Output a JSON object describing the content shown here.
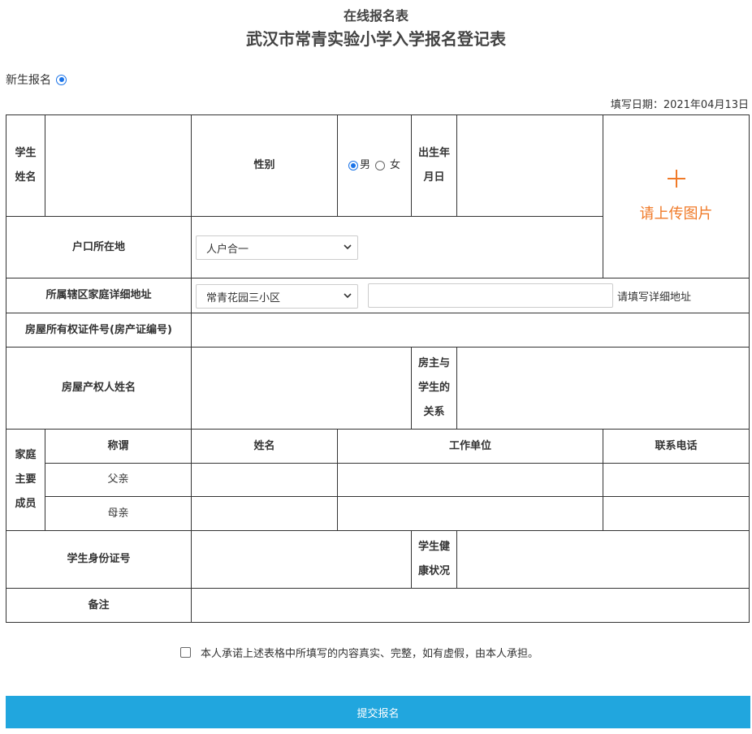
{
  "header": {
    "subtitle": "在线报名表",
    "title": "武汉市常青实验小学入学报名登记表"
  },
  "registration_type": {
    "label": "新生报名",
    "selected": true
  },
  "fill_date": "填写日期：2021年04月13日",
  "form": {
    "student_name_label": "学生姓名",
    "gender_label": "性别",
    "gender_options": [
      "男",
      "女"
    ],
    "gender_selected": "男",
    "birth_label": "出生年月日",
    "upload_label": "请上传图片",
    "hukou_label": "户口所在地",
    "hukou_value": "人户合一",
    "address_label": "所属辖区家庭详细地址",
    "address_select_value": "常青花园三小区",
    "address_hint": "请填写详细地址",
    "property_cert_label": "房屋所有权证件号(房产证编号)",
    "owner_name_label": "房屋产权人姓名",
    "owner_relation_label": "房主与学生的关系",
    "family_label": "家庭主要成员",
    "family_headers": [
      "称谓",
      "姓名",
      "工作单位",
      "联系电话"
    ],
    "family_rows": [
      "父亲",
      "母亲"
    ],
    "id_label": "学生身份证号",
    "health_label": "学生健康状况",
    "remarks_label": "备注"
  },
  "pledge_text": "本人承诺上述表格中所填写的内容真实、完整，如有虚假，由本人承担。",
  "submit_label": "提交报名",
  "colors": {
    "submit_bg": "#21a6de",
    "upload_accent": "#f07a28",
    "radio_accent": "#1a73e8"
  }
}
